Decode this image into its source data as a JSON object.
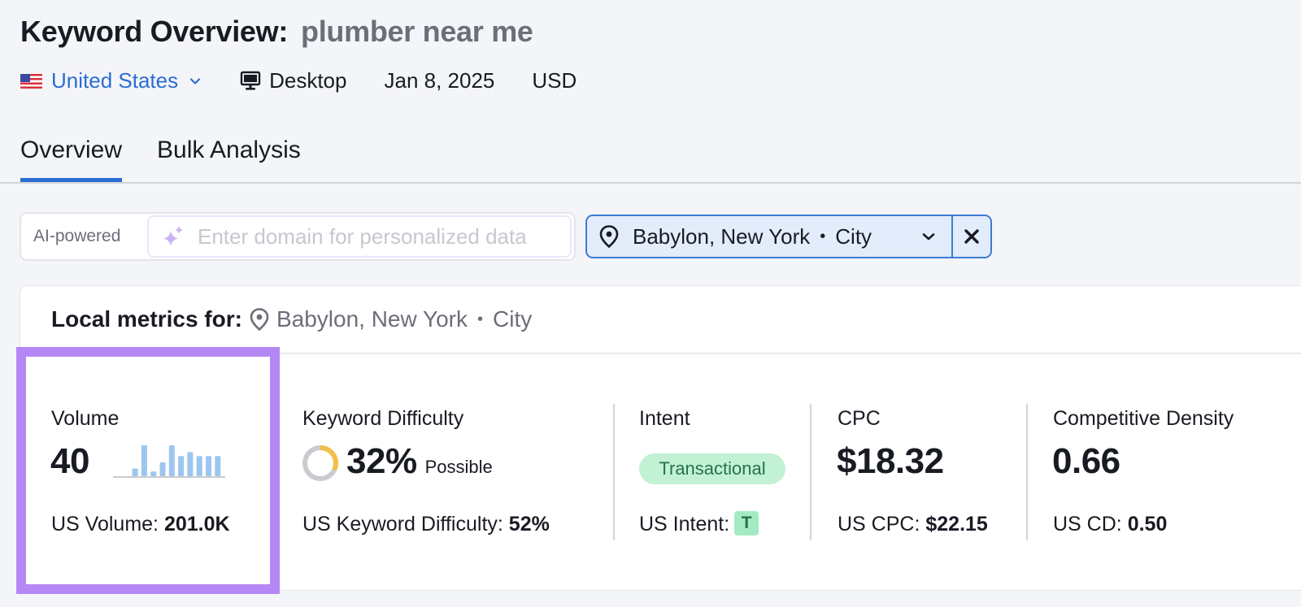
{
  "header": {
    "title": "Keyword Overview:",
    "keyword": "plumber near me",
    "country": "United States",
    "country_icon": "us-flag-icon",
    "device": "Desktop",
    "device_icon": "desktop-monitor-icon",
    "date": "Jan 8, 2025",
    "currency": "USD"
  },
  "tabs": [
    {
      "label": "Overview",
      "active": true
    },
    {
      "label": "Bulk Analysis",
      "active": false
    }
  ],
  "ai_search": {
    "label": "AI-powered",
    "icon": "sparkle-icon",
    "value": "",
    "placeholder": "Enter domain for personalized data"
  },
  "location_filter": {
    "icon": "map-pin-icon",
    "place": "Babylon, New York",
    "separator": "•",
    "type": "City",
    "dropdown_icon": "chevron-down-icon",
    "clear_icon": "close-icon"
  },
  "local_metrics": {
    "label": "Local metrics for:",
    "place": "Babylon, New York",
    "separator": "•",
    "type": "City"
  },
  "metrics": {
    "volume": {
      "label": "Volume",
      "value": "40",
      "sub_label": "US Volume:",
      "sub_value": "201.0K",
      "trend_relative": [
        0,
        0,
        0.25,
        1.0,
        0.15,
        0.45,
        1.0,
        0.65,
        0.78,
        0.65,
        0.65,
        0.65
      ],
      "bar_color": "#9cc6ee",
      "highlighted": true,
      "highlight_color": "#b587f5"
    },
    "keyword_difficulty": {
      "label": "Keyword Difficulty",
      "value": "32%",
      "percent": 32,
      "rating": "Possible",
      "sub_label": "US Keyword Difficulty:",
      "sub_value": "52%",
      "ring_color": "#f2bf48",
      "ring_track_color": "#c9cbd1"
    },
    "intent": {
      "label": "Intent",
      "badge": "Transactional",
      "sub_label": "US Intent:",
      "sub_value": "T"
    },
    "cpc": {
      "label": "CPC",
      "value": "$18.32",
      "sub_label": "US CPC:",
      "sub_value": "$22.15"
    },
    "competitive_density": {
      "label": "Competitive Density",
      "value": "0.66",
      "sub_label": "US CD:",
      "sub_value": "0.50"
    }
  }
}
